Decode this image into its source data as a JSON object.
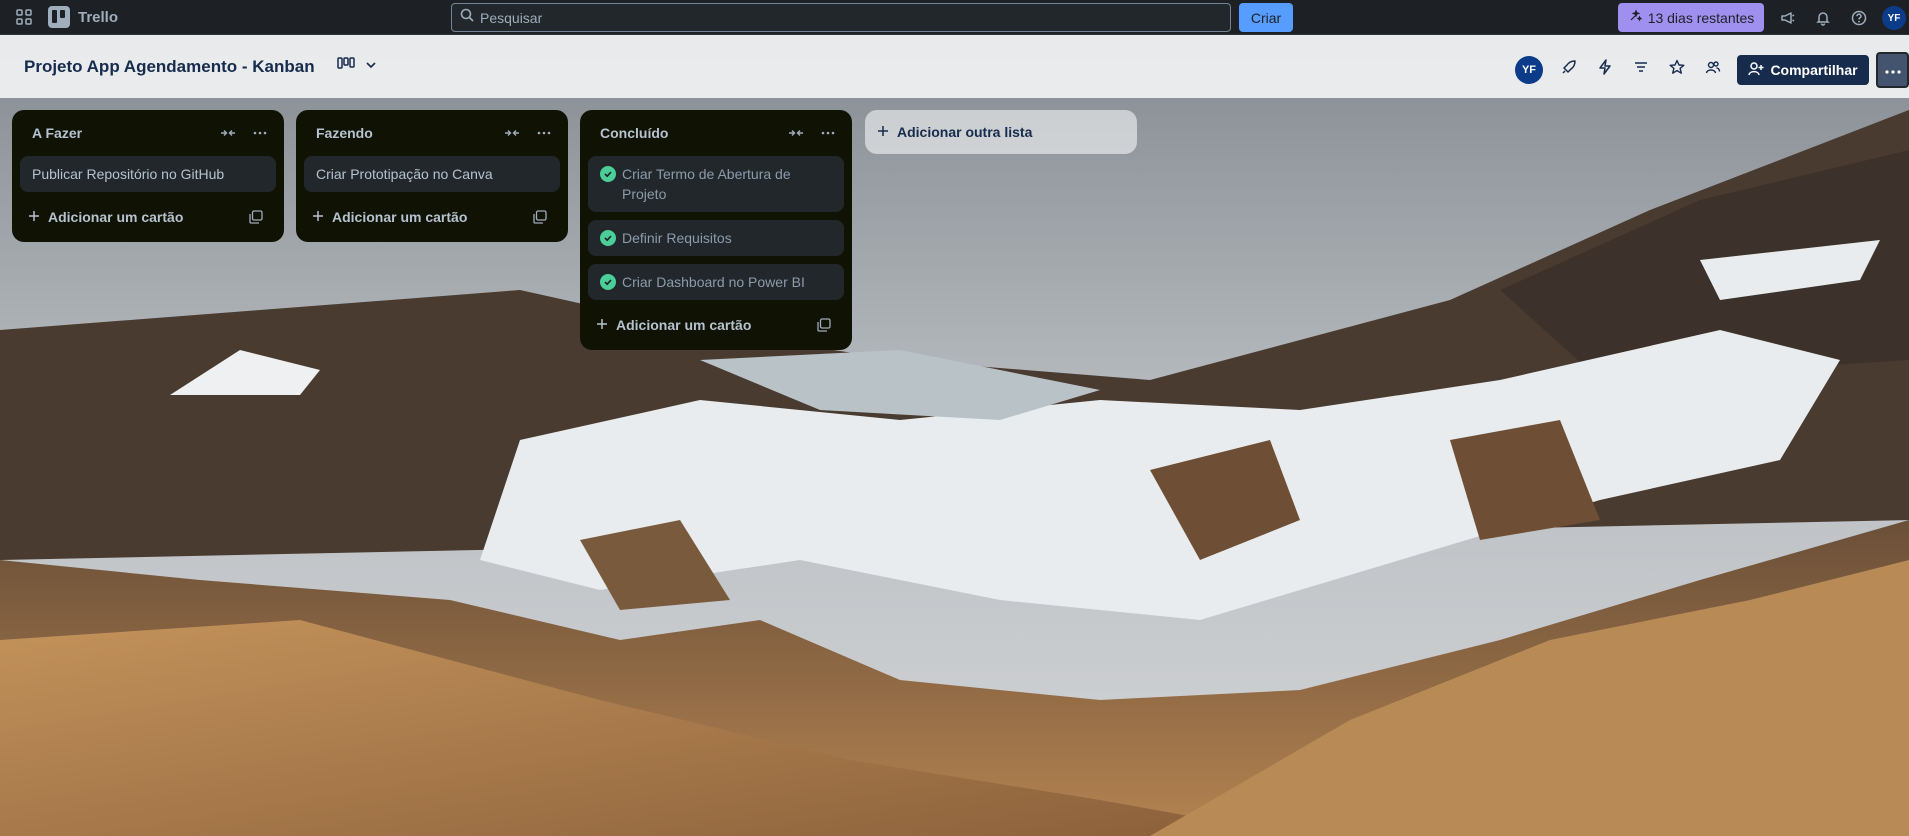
{
  "topbar": {
    "app_name": "Trello",
    "search_placeholder": "Pesquisar",
    "create_label": "Criar",
    "trial_label": "13 dias restantes",
    "avatar_initials": "YF"
  },
  "board": {
    "title": "Projeto App Agendamento - Kanban",
    "avatar_initials": "YF",
    "share_label": "Compartilhar"
  },
  "lists": [
    {
      "title": "A Fazer",
      "cards": [
        {
          "text": "Publicar Repositório no GitHub",
          "done": false
        }
      ],
      "add_card_label": "Adicionar um cartão"
    },
    {
      "title": "Fazendo",
      "cards": [
        {
          "text": "Criar Prototipação no Canva",
          "done": false
        }
      ],
      "add_card_label": "Adicionar um cartão"
    },
    {
      "title": "Concluído",
      "cards": [
        {
          "text": "Criar Termo de Abertura de Projeto",
          "done": true
        },
        {
          "text": "Definir Requisitos",
          "done": true
        },
        {
          "text": "Criar Dashboard no Power BI",
          "done": true
        }
      ],
      "add_card_label": "Adicionar um cartão"
    }
  ],
  "add_list_label": "Adicionar outra lista",
  "icons": {
    "apps": "grid-icon",
    "search": "search-icon",
    "trial": "sparkle-icon",
    "announcements": "megaphone-icon",
    "notifications": "bell-icon",
    "help": "help-icon",
    "view": "board-view-icon",
    "power_ups": "rocket-icon",
    "automation": "lightning-icon",
    "filter": "filter-icon",
    "star": "star-icon",
    "visibility": "team-icon",
    "collapse": "collapse-icon",
    "more": "more-icon",
    "template": "template-icon",
    "done_check": "check-circle-icon"
  },
  "colors": {
    "topbar_bg": "#1d2125",
    "list_bg": "#101204",
    "card_bg": "#22272b",
    "create_button": "#579dff",
    "trial_button": "#9f8fef",
    "share_button": "#172b4d",
    "done_check": "#4bce97"
  }
}
